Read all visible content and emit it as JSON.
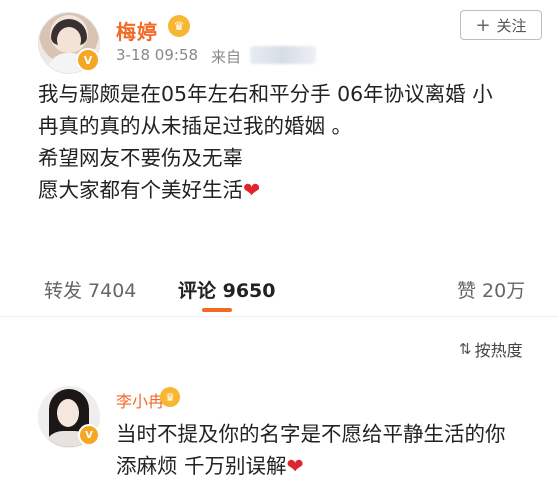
{
  "post": {
    "author": "梅婷",
    "time": "3-18 09:58",
    "source_label": "来自",
    "follow_label": "关注",
    "lines": [
      "我与鄢颇是在05年左右和平分手  06年协议离婚 小",
      "冉真的真的从未插足过我的婚姻 。",
      "希望网友不要伤及无辜",
      "愿大家都有个美好生活"
    ],
    "heart": "❤"
  },
  "stats": {
    "repost": "转发 7404",
    "comment": "评论 9650",
    "like": "赞 20万"
  },
  "sort_label": "按热度",
  "comment": {
    "author": "李小冉",
    "lines": [
      "当时不提及你的名字是不愿给平静生活的你",
      "添麻烦 千万别误解"
    ],
    "heart": "❤"
  },
  "colors": {
    "accent": "#f26a26",
    "heart": "#e0242e",
    "badge": "#f5a623"
  },
  "icons": [
    "avatar",
    "verified-badge-icon",
    "vip-icon",
    "plus-icon",
    "sort-icon",
    "heart-icon"
  ]
}
